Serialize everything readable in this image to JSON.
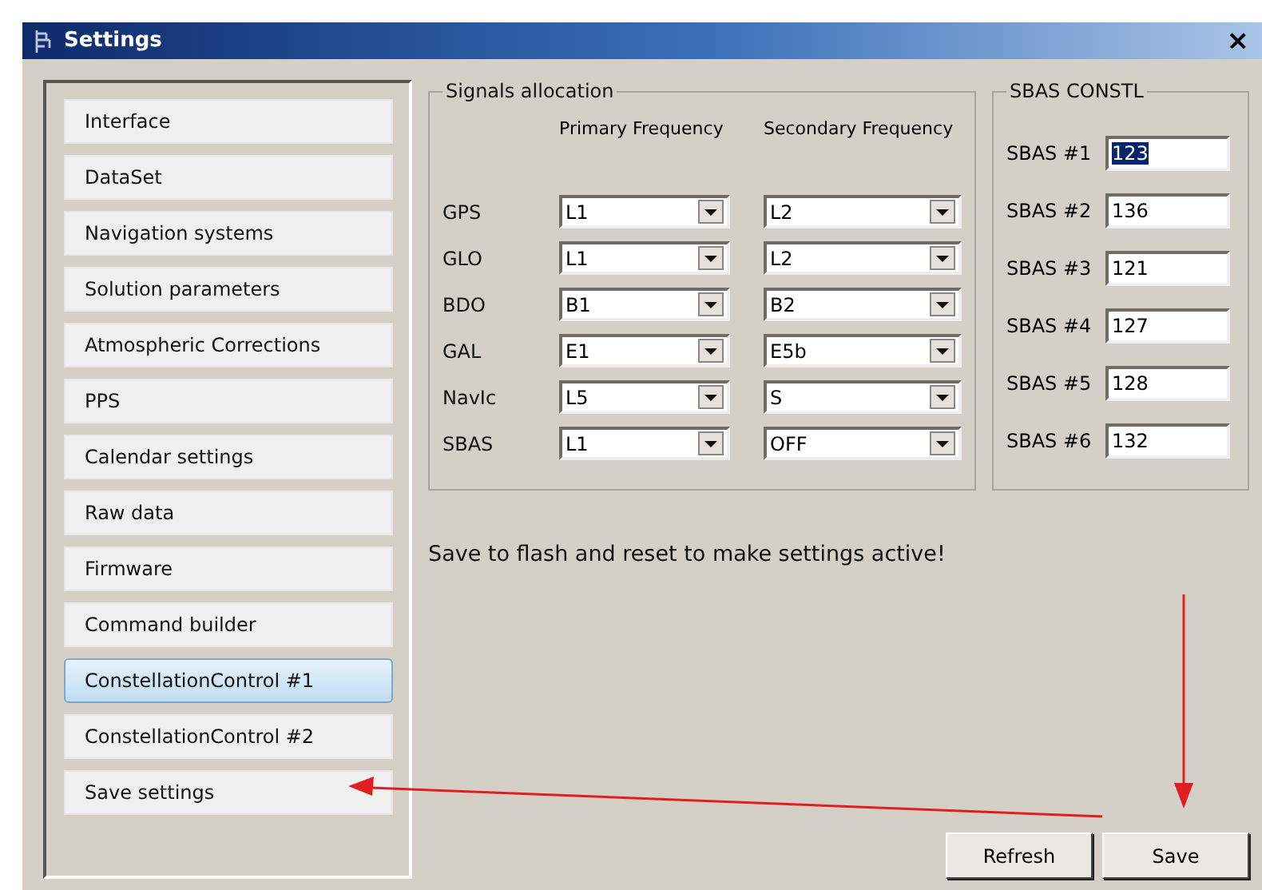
{
  "window": {
    "title": "Settings",
    "close": "×"
  },
  "sidebar": {
    "items": [
      {
        "label": "Interface",
        "selected": false
      },
      {
        "label": "DataSet",
        "selected": false
      },
      {
        "label": "Navigation systems",
        "selected": false
      },
      {
        "label": "Solution parameters",
        "selected": false
      },
      {
        "label": "Atmospheric Corrections",
        "selected": false
      },
      {
        "label": "PPS",
        "selected": false
      },
      {
        "label": "Calendar settings",
        "selected": false
      },
      {
        "label": "Raw data",
        "selected": false
      },
      {
        "label": "Firmware",
        "selected": false
      },
      {
        "label": "Command builder",
        "selected": false
      },
      {
        "label": "ConstellationControl #1",
        "selected": true
      },
      {
        "label": "ConstellationControl #2",
        "selected": false
      },
      {
        "label": "Save settings",
        "selected": false
      }
    ]
  },
  "signals_allocation": {
    "title": "Signals allocation",
    "columns": [
      "Primary Frequency",
      "Secondary Frequency"
    ],
    "rows": [
      {
        "system": "GPS",
        "primary": "L1",
        "secondary": "L2"
      },
      {
        "system": "GLO",
        "primary": "L1",
        "secondary": "L2"
      },
      {
        "system": "BDO",
        "primary": "B1",
        "secondary": "B2"
      },
      {
        "system": "GAL",
        "primary": "E1",
        "secondary": "E5b"
      },
      {
        "system": "NavIc",
        "primary": "L5",
        "secondary": "S"
      },
      {
        "system": "SBAS",
        "primary": "L1",
        "secondary": "OFF"
      }
    ]
  },
  "sbas_constl": {
    "title": "SBAS CONSTL",
    "fields": [
      {
        "label": "SBAS #1",
        "value": "123",
        "text_selected": true
      },
      {
        "label": "SBAS #2",
        "value": "136",
        "text_selected": false
      },
      {
        "label": "SBAS #3",
        "value": "121",
        "text_selected": false
      },
      {
        "label": "SBAS #4",
        "value": "127",
        "text_selected": false
      },
      {
        "label": "SBAS #5",
        "value": "128",
        "text_selected": false
      },
      {
        "label": "SBAS #6",
        "value": "132",
        "text_selected": false
      }
    ]
  },
  "message": "Save to flash and reset to make settings active!",
  "buttons": [
    "Refresh",
    "Save"
  ]
}
